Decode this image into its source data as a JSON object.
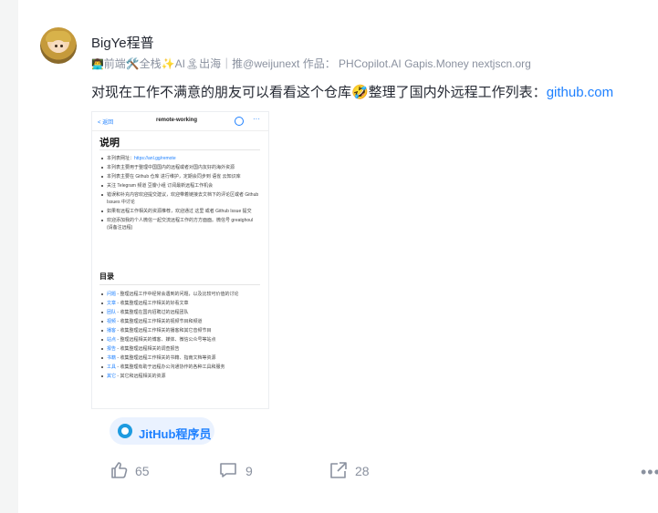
{
  "author": {
    "name": "BigYe程普",
    "bio": "前端🛠️全栈✨AI🏝出海｜推@weijunext 作品： PHCopilot.AI Gapis.Money nextjscn.org",
    "bio_prefix_icon": "👨‍💻"
  },
  "post": {
    "text": "对现在工作不满意的朋友可以看看这个仓库🤣整理了国内外远程工作列表：",
    "link": "github.com"
  },
  "preview": {
    "back": "< 返回",
    "title": "remote-working",
    "heading": "说明",
    "intro_items": [
      {
        "text": "本列表网址：",
        "link": "https://anl.gg/remote"
      },
      {
        "text": "本列表主要用于整理中国国内的远程或者对国内友好的海外资源",
        "link": ""
      },
      {
        "text": "本列表主要在 Github 仓库 进行维护，定期会同步到 语雀 云知识库",
        "link": ""
      },
      {
        "text": "关注 Telegram 频道 豆瓣小组 订阅最新远程工作机会",
        "link": ""
      },
      {
        "text": "错误和补充内容欢迎提交建议，欢迎带着链接去文档下的评论区或者 Github Issues 中讨论",
        "link": ""
      },
      {
        "text": "如果有远程工作相关的资源推荐，欢迎通过 这里 或者 Github Issue 提交",
        "link": ""
      },
      {
        "text": "欢迎添加我的个人微信一起交流远程工作的方方面面。微信号 greatghoul (请备注远程)",
        "link": ""
      }
    ],
    "toc_heading": "目录",
    "toc_items": [
      {
        "label": "问题",
        "text": " - 整理远程工作中经常会遇到的问题，以及比较可价值的讨论"
      },
      {
        "label": "文章",
        "text": " - 收集整理远程工作相关的好看文章"
      },
      {
        "label": "团队",
        "text": " - 收集整理在国内招聘过的远程团队"
      },
      {
        "label": "视频",
        "text": " - 收集整理远程工作相关的视频节目和频道"
      },
      {
        "label": "播客",
        "text": " - 收集整理远程工作相关的播客和其它音频节目"
      },
      {
        "label": "站点",
        "text": " - 整理远程相关的博客、媒体、微信公众号等站点"
      },
      {
        "label": "报告",
        "text": " - 收集整理远程相关的调查报告"
      },
      {
        "label": "书籍",
        "text": " - 收集整理远程工作相关的书籍、指南文档等资源"
      },
      {
        "label": "工具",
        "text": " - 收集整理有助于远程办公沟通协作的各种工具和服务"
      },
      {
        "label": "其它",
        "text": " - 其它和远程相关的资源"
      }
    ]
  },
  "tag": {
    "label": "JitHub程序员"
  },
  "actions": {
    "like_count": "65",
    "comment_count": "9",
    "share_count": "28"
  },
  "colors": {
    "accent": "#1e80ff",
    "muted": "#8a919f",
    "text": "#252933"
  }
}
